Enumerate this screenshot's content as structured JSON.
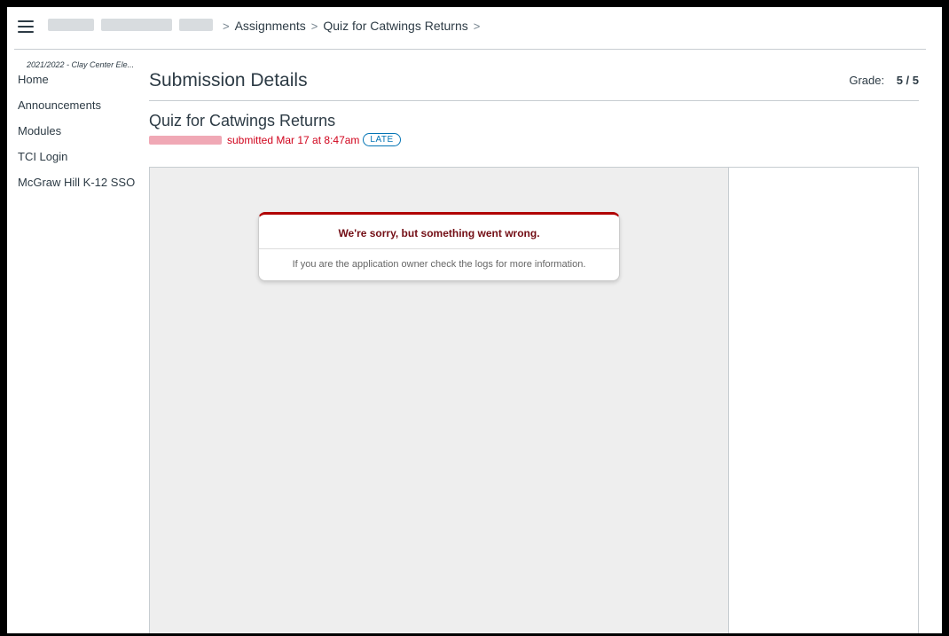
{
  "breadcrumb": {
    "items": [
      "Assignments",
      "Quiz for Catwings Returns"
    ],
    "separator": ">"
  },
  "leftnav": {
    "term": "2021/2022 - Clay Center Ele...",
    "items": [
      "Home",
      "Announcements",
      "Modules",
      "TCI Login",
      "McGraw Hill K-12 SSO"
    ]
  },
  "page": {
    "title": "Submission Details",
    "grade_label": "Grade:",
    "grade_value": "5 / 5"
  },
  "submission": {
    "quiz_title": "Quiz for Catwings Returns",
    "submitted_text": "submitted Mar 17 at 8:47am",
    "late_badge": "LATE"
  },
  "error": {
    "title": "We're sorry, but something went wrong.",
    "message": "If you are the application owner check the logs for more information."
  },
  "colors": {
    "accent": "#0374b5",
    "late_red": "#d0021b",
    "error_red": "#b00000"
  },
  "icons": {
    "menu": "hamburger-icon"
  }
}
